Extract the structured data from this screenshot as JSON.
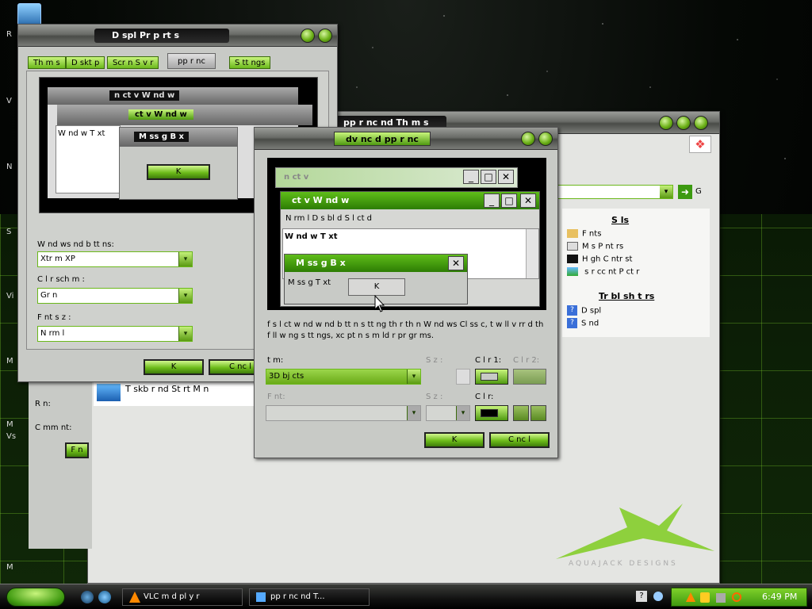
{
  "desktop": {
    "labels": [
      "R",
      "V",
      "N",
      "S",
      "Vi",
      "M",
      "M",
      "Vs",
      "M"
    ]
  },
  "display_properties": {
    "title": "D spl   Pr p rt  s",
    "tabs": [
      "Th m s",
      "D skt p",
      "Scr  n S v r",
      "pp   r nc",
      "S tt ngs"
    ],
    "selected_tab": "pp   r nc",
    "preview": {
      "inactive_title": "n ct v   W nd w",
      "active_title": "ct v   W nd w",
      "window_text": "W nd w T xt",
      "msgbox_title": "M ss g   B x",
      "ok": "K"
    },
    "windows_buttons_label": "W nd ws  nd b tt ns:",
    "windows_buttons_value": "Xtr m  XP",
    "color_scheme_label": "C l r sch m :",
    "color_scheme_value": "Gr  n",
    "font_size_label": "F nt s z :",
    "font_size_value": "N rm l",
    "ok_label": "K",
    "cancel_label": "C nc l"
  },
  "back_window": {
    "title": "pp   r nc    nd Th m s",
    "address_go": "G",
    "see_also_title": "S       ls",
    "see_also_items": [
      "F nts",
      "M  s  P  nt rs",
      "H gh C ntr st",
      "  s r    cc   nt P ct r"
    ],
    "troubleshooters_title": "Tr  bl sh   t rs",
    "troubleshooters_items": [
      "D spl",
      "S  nd"
    ],
    "taskbar_item": "T skb r  nd St rt M n",
    "run_label": "R  n:",
    "comment_label": "C mm nt:",
    "find_button": "F n",
    "watermark": "AQUAJACK   DESIGNS"
  },
  "advanced_appearance": {
    "title": "dv nc d    pp   r nc",
    "preview": {
      "inactive_title": "n ct v",
      "active_title": "ct v   W nd w",
      "menu_items": [
        "N rm l",
        "D s bl d",
        "S l ct d"
      ],
      "window_text": "W nd w T xt",
      "msgbox_title": "M ss g   B x",
      "message_text": "M ss g   T xt",
      "ok": "K"
    },
    "help_text": "f     s l ct    w nd w   nd b tt n s tt ng  th r th n W nd ws Cl ss c,  t w ll  v rr d  th  f ll w ng s tt ngs,   xc pt  n s m    ld r pr gr ms.",
    "item_label": "t m:",
    "item_value": "3D   bj cts",
    "size_label": "S z :",
    "color1_label": "C l r 1:",
    "color2_label": "C l r 2:",
    "font_label": "F nt:",
    "font_size_label": "S z :",
    "font_color_label": "C l r:",
    "ok_label": "K",
    "cancel_label": "C nc l"
  },
  "taskbar": {
    "items": [
      "VLC m d   pl  y r",
      "pp   r nc    nd T..."
    ],
    "clock": "6:49 PM"
  },
  "colors": {
    "accent_green": "#6cbb1a",
    "xp_title_green": "#3f9a10"
  }
}
